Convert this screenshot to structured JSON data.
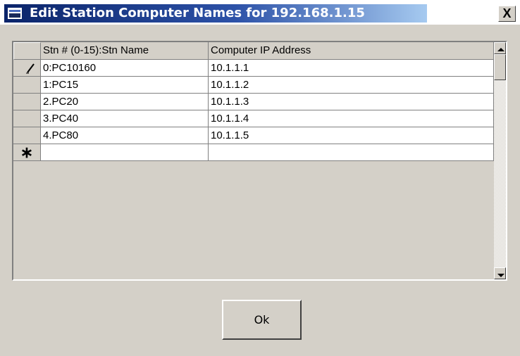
{
  "window": {
    "title": "Edit Station Computer Names for 192.168.1.15",
    "close_label": "X",
    "title_gradient": [
      "#0a246a",
      "#a6caf0"
    ]
  },
  "grid": {
    "columns": [
      "Stn # (0-15):Stn Name",
      "Computer IP Address"
    ],
    "rows": [
      {
        "indicator": "pencil",
        "name": "0:PC10160",
        "ip": "10.1.1.1"
      },
      {
        "indicator": "",
        "name": "1:PC15",
        "ip": "10.1.1.2"
      },
      {
        "indicator": "",
        "name": "2.PC20",
        "ip": "10.1.1.3"
      },
      {
        "indicator": "",
        "name": "3.PC40",
        "ip": "10.1.1.4"
      },
      {
        "indicator": "",
        "name": "4.PC80",
        "ip": "10.1.1.5"
      }
    ],
    "new_row_indicator": "∗",
    "new_row": {
      "name": "",
      "ip": ""
    }
  },
  "buttons": {
    "ok_label": "Ok"
  }
}
